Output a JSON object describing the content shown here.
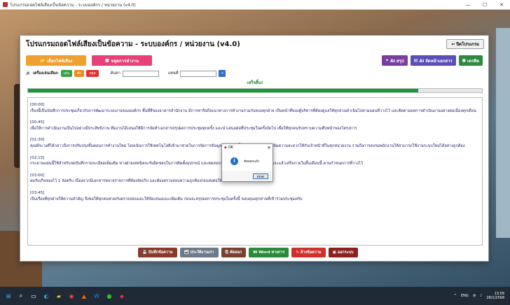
{
  "window": {
    "title": "โปรแกรมถอดไฟล์เสียงเป็นข้อความ - ระบบองค์กร / หน่วยงาน (v4.0)",
    "controls": [
      "—",
      "☐",
      "✕"
    ]
  },
  "app": {
    "title": "โปรแกรมถอดไฟล์เสียงเป็นข้อความ - ระบบองค์กร / หน่วยงาน (v4.0)",
    "close_label": "ปิดโปรแกรม",
    "btn_select_file": "เลือกไฟล์เสียง",
    "btn_stop": "หยุดการทำงาน",
    "btn_ai_summary": "AI สรุป",
    "btn_ai_format": "AI จัดหน้าเอกสาร",
    "btn_credits": "เครดิต",
    "player_label": "เครื่องเล่นเสียง:",
    "chip_play": "เล่น",
    "chip_pause": "พัก",
    "chip_stop": "หยุด",
    "search_label": "ค้นหา",
    "replace_label": "แทนที่",
    "status": "เสร็จสิ้น!",
    "progress_percent": 86,
    "transcript": [
      {
        "ts": "[00:00]",
        "text": "เรื่องนี้เป็นบันทึกการประชุมเกี่ยวกับการพัฒนาระบบงานขององค์กร ชั้นที่สี่ของอาคารสำนักงาน มีการหารือถึงแนวทางการทำงานร่วมกันของทุกฝ่าย เป็นหน้าที่ของผู้บริหารที่ต้องดูแลให้ทุกส่วนดำเนินไปตามแผนที่วางไว้ และติดตามผลการดำเนินงานอย่างต่อเนื่องทุกเดือน"
      },
      {
        "ts": "[00:45]",
        "text": "เพื่อให้การดำเนินงานเป็นไปอย่างมีประสิทธิภาพ ทีมงานได้เสนอให้มีการจัดทำเอกสารสรุปผลการประชุมทุกครั้ง และนำเสนอต่อที่ประชุมในครั้งถัดไป เพื่อให้ทุกคนรับทราบความคืบหน้าของโครงการ"
      },
      {
        "ts": "[01:30]",
        "text": "คุณพีระวงศ์ได้กล่าวถึงการปรับปรุงขั้นตอนการทำงานใหม่ โดยเน้นการใช้เทคโนโลยีเข้ามาช่วยในการจัดการข้อมูล ลดความซ้ำซ้อนของงาน และเพิ่มความสะดวกให้กับเจ้าหน้าที่ในทุกหน่วยงาน รวมถึงการอบรมพนักงานให้สามารถใช้งานระบบใหม่ได้อย่างถูกต้อง"
      },
      {
        "ts": "[02:15]",
        "text": "กระดาษแผ่นนี้ใช้สำหรับจดบันทึกรายละเอียดเพิ่มเติม ทางฝ่ายเทคนิคจะรับผิดชอบในการติดตั้งอุปกรณ์ และทดสอบระบบก่อนเปิดใช้งานจริง คาดว่าจะแล้วเสร็จภายในสิ้นเดือนนี้ ตามกำหนดการที่วางไว้"
      },
      {
        "ts": "[03:00]",
        "text": "ผมรับเก็บของไว้ 1 ลังครับ เนื่องจากมีเอกสารหลายรายการที่ต้องจัดเก็บ และต้องตรวจสอบความถูกต้องก่อนส่งต่อให้ฝ่ายที่เกี่ยวข้องพิจารณา"
      },
      {
        "ts": "[03:45]",
        "text": "เป็นเรื่องที่ทุกฝ่ายให้ความสำคัญ จึงขอให้ทุกคนช่วยกันตรวจสอบและให้ข้อเสนอแนะเพิ่มเติม ก่อนจะสรุปผลการประชุมในครั้งนี้ ขอบคุณทุกท่านที่เข้าร่วมประชุมครับ"
      }
    ],
    "bottom": {
      "save": "บันทึกข้อความ",
      "history": "ประวัติงานเก่า",
      "copy": "คัดลอก",
      "word": "Word ทางการ",
      "clear": "ล้างข้อความ",
      "exit": "ออกระบบ"
    }
  },
  "dialog": {
    "title": "OK",
    "message": "คัดลอกแล้ว",
    "ok": "ตกลง"
  },
  "taskbar": {
    "lang": "ENG",
    "time": "13:09",
    "date": "28/1/2568"
  }
}
